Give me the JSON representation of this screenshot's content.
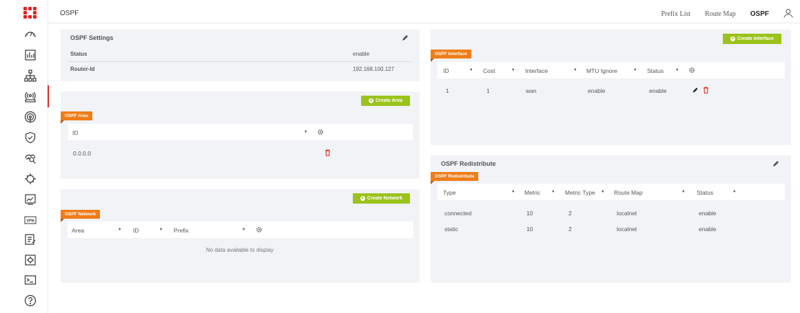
{
  "app": {
    "page_title": "OSPF"
  },
  "topnav": {
    "items": [
      "Prefix List",
      "Route Map",
      "OSPF"
    ],
    "active": "OSPF"
  },
  "sidebar": {
    "icons": [
      "dashboard-icon",
      "chart-icon",
      "network-icon",
      "routing-icon",
      "wireless-icon",
      "shield-icon",
      "monitor-icon",
      "cloud-icon",
      "graph-icon",
      "vpn-icon",
      "log-icon",
      "settings-icon",
      "terminal-icon",
      "help-icon"
    ],
    "vpn_label": "VPN"
  },
  "ospf_settings": {
    "title": "OSPF Settings",
    "rows": [
      {
        "label": "Status",
        "value": "enable"
      },
      {
        "label": "Router-Id",
        "value": "192.168.100.127"
      }
    ]
  },
  "ospf_area": {
    "tag": "OSPF Area",
    "create_label": "Create Area",
    "columns": [
      "ID"
    ],
    "rows": [
      {
        "id": "0.0.0.0"
      }
    ]
  },
  "ospf_network": {
    "tag": "OSPF Network",
    "create_label": "Create Network",
    "columns": [
      "Area",
      "ID",
      "Prefix"
    ],
    "empty_text": "No data available to display"
  },
  "ospf_interface": {
    "tag": "OSPF Interface",
    "create_label": "Create Interface",
    "columns": [
      "ID",
      "Cost",
      "Interface",
      "MTU Ignore",
      "Status"
    ],
    "rows": [
      {
        "id": "1",
        "cost": "1",
        "interface": "wan",
        "mtu_ignore": "enable",
        "status": "enable"
      }
    ]
  },
  "ospf_redistribute": {
    "title": "OSPF Redistribute",
    "tag": "OSPF Redistribute",
    "columns": [
      "Type",
      "Metric",
      "Metric Type",
      "Route Map",
      "Status"
    ],
    "rows": [
      {
        "type": "connected",
        "metric": "10",
        "metric_type": "2",
        "route_map": "localnet",
        "status": "enable"
      },
      {
        "type": "static",
        "metric": "10",
        "metric_type": "2",
        "route_map": "localnet",
        "status": "enable"
      }
    ]
  },
  "colors": {
    "brand_red": "#e1241f",
    "accent_green": "#9bc31c",
    "tag_orange": "#f07d1a",
    "panel_bg": "#f1f3f6",
    "delete_red": "#e03a2f"
  }
}
